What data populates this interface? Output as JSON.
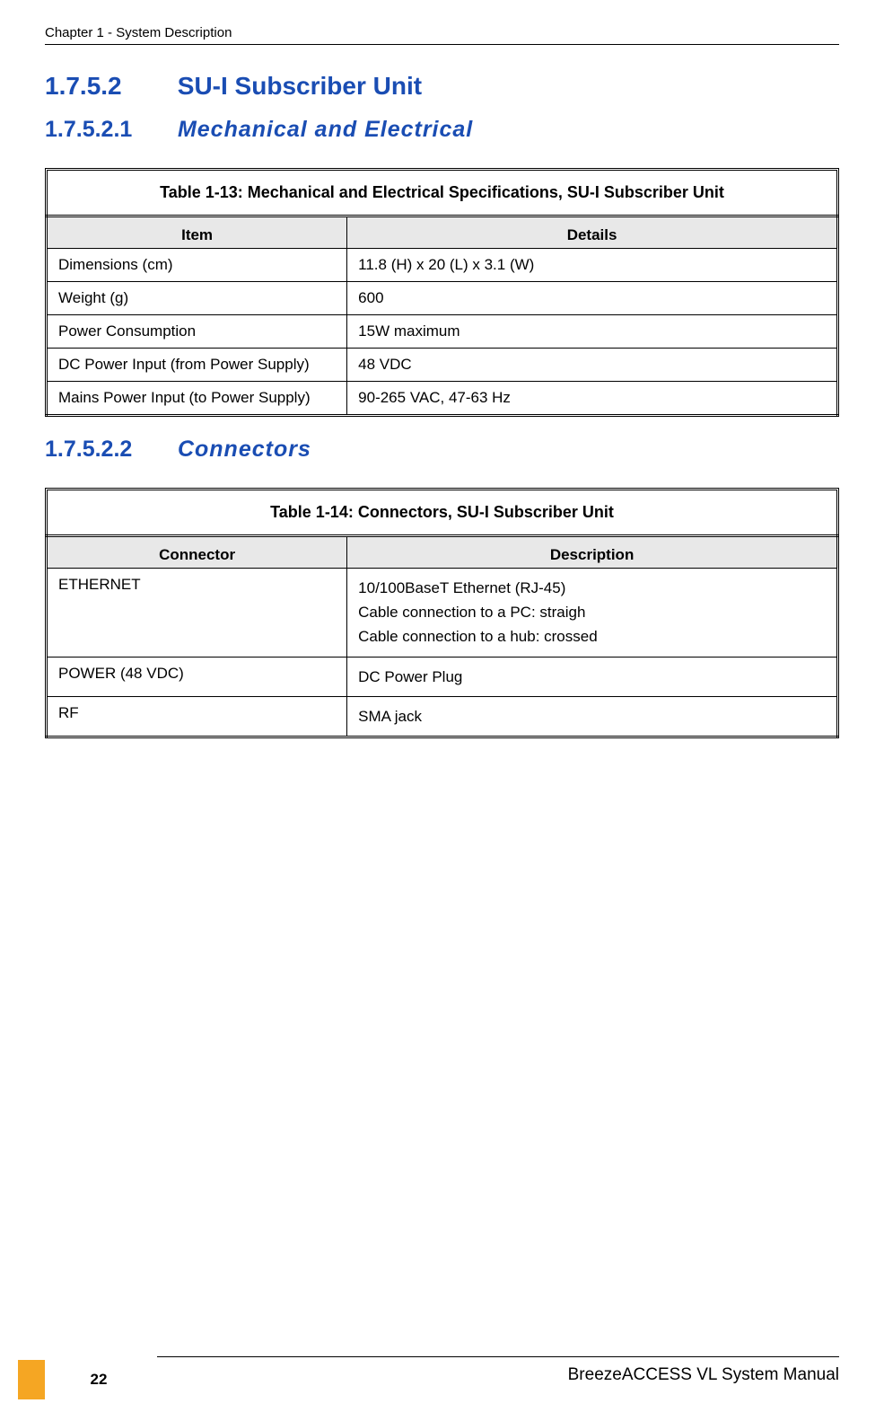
{
  "header": {
    "chapter": "Chapter 1 - System Description"
  },
  "sections": {
    "s1": {
      "number": "1.7.5.2",
      "title": "SU-I Subscriber Unit"
    },
    "s1_1": {
      "number": "1.7.5.2.1",
      "title": "Mechanical and Electrical"
    },
    "s1_2": {
      "number": "1.7.5.2.2",
      "title": "Connectors"
    }
  },
  "table13": {
    "caption": "Table 1-13: Mechanical and Electrical Specifications, SU-I Subscriber Unit",
    "headers": {
      "col1": "Item",
      "col2": "Details"
    },
    "rows": [
      {
        "item": "Dimensions (cm)",
        "details": "11.8 (H) x 20 (L) x 3.1 (W)"
      },
      {
        "item": "Weight (g)",
        "details": "600"
      },
      {
        "item": "Power Consumption",
        "details": "15W maximum"
      },
      {
        "item": "DC Power Input (from Power Supply)",
        "details": "48 VDC"
      },
      {
        "item": "Mains Power Input (to Power Supply)",
        "details": "90-265 VAC, 47-63 Hz"
      }
    ]
  },
  "table14": {
    "caption": "Table 1-14: Connectors, SU-I Subscriber Unit",
    "headers": {
      "col1": "Connector",
      "col2": "Description"
    },
    "rows": [
      {
        "connector": "ETHERNET",
        "desc_lines": [
          "10/100BaseT Ethernet (RJ-45)",
          "Cable connection to a PC: straigh",
          "Cable connection to a hub: crossed"
        ]
      },
      {
        "connector": "POWER (48 VDC)",
        "desc_lines": [
          "DC Power Plug"
        ]
      },
      {
        "connector": "RF",
        "desc_lines": [
          "SMA jack"
        ]
      }
    ]
  },
  "footer": {
    "manual": "BreezeACCESS VL System Manual",
    "page": "22"
  }
}
